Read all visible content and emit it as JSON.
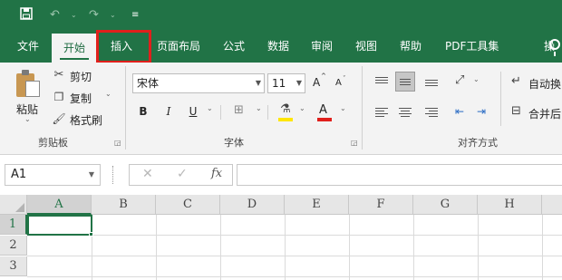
{
  "title_bar": {
    "save_icon": "save-icon",
    "undo_icon": "undo-icon",
    "redo_icon": "redo-icon",
    "customize_icon": "customize-quick-access-icon"
  },
  "tabs": [
    {
      "label": "文件"
    },
    {
      "label": "开始"
    },
    {
      "label": "插入"
    },
    {
      "label": "页面布局"
    },
    {
      "label": "公式"
    },
    {
      "label": "数据"
    },
    {
      "label": "审阅"
    },
    {
      "label": "视图"
    },
    {
      "label": "帮助"
    },
    {
      "label": "PDF工具集"
    },
    {
      "label": "操"
    }
  ],
  "clipboard": {
    "paste_label": "粘贴",
    "cut_label": "剪切",
    "copy_label": "复制",
    "format_painter_label": "格式刷",
    "group_label": "剪贴板"
  },
  "font": {
    "font_name": "宋体",
    "font_size": "11",
    "bold": "B",
    "italic": "I",
    "underline": "U",
    "increase_font": "A",
    "decrease_font": "A",
    "font_color_letter": "A",
    "group_label": "字体"
  },
  "alignment": {
    "wrap_text_label": "自动换",
    "merge_label": "合并后",
    "group_label": "对齐方式"
  },
  "formula_bar": {
    "name_box": "A1",
    "cancel": "✕",
    "enter": "✓",
    "fx": "fx",
    "formula": ""
  },
  "grid": {
    "columns": [
      "A",
      "B",
      "C",
      "D",
      "E",
      "F",
      "G",
      "H"
    ],
    "rows": [
      "1",
      "2",
      "3"
    ],
    "selected_cell": "A1"
  },
  "colors": {
    "accent": "#217346",
    "highlight_box": "#e0201c",
    "font_color": "#e0201c",
    "fill_color": "#ffe600"
  }
}
